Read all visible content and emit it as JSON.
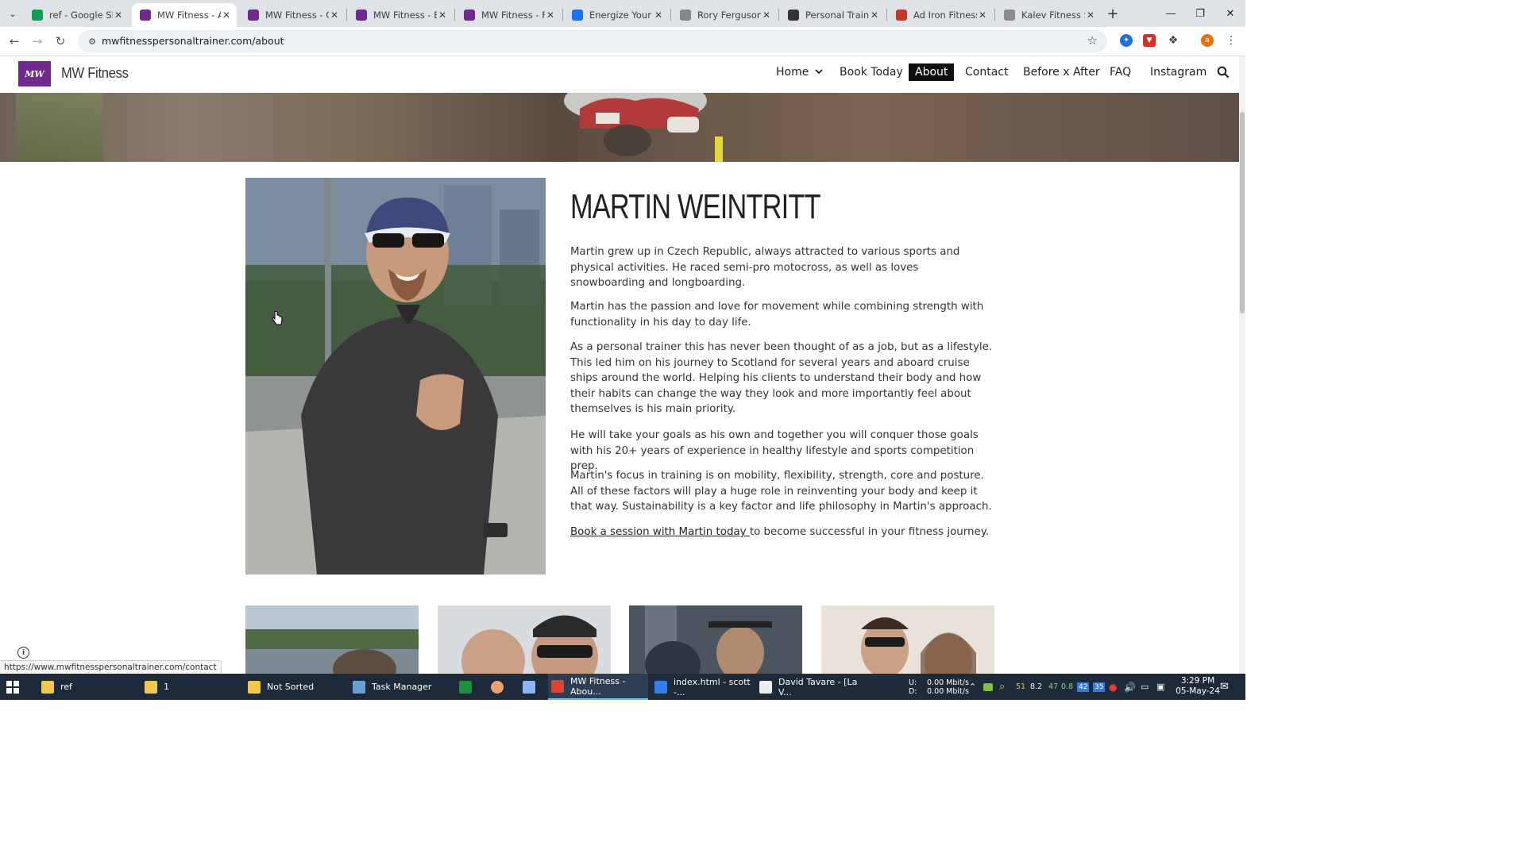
{
  "browser": {
    "tabs": [
      {
        "title": "ref - Google Shee",
        "favicon_color": "#0f9d58",
        "active": false
      },
      {
        "title": "MW Fitness - Abo",
        "favicon_color": "#6f2a8e",
        "active": true
      },
      {
        "title": "MW Fitness - Con",
        "favicon_color": "#6f2a8e",
        "active": false
      },
      {
        "title": "MW Fitness - Befo",
        "favicon_color": "#6f2a8e",
        "active": false
      },
      {
        "title": "MW Fitness - FAQ",
        "favicon_color": "#6f2a8e",
        "active": false
      },
      {
        "title": "Energize Your Fitn",
        "favicon_color": "#1a73e8",
        "active": false
      },
      {
        "title": "Rory Ferguson - P",
        "favicon_color": "#888888",
        "active": false
      },
      {
        "title": "Personal Trainer V",
        "favicon_color": "#333333",
        "active": false
      },
      {
        "title": "Ad Iron Fitness",
        "favicon_color": "#c0392b",
        "active": false
      },
      {
        "title": "Kalev Fitness Solu",
        "favicon_color": "#8a8a8a",
        "active": false
      }
    ],
    "url": "mwfitnesspersonaltrainer.com/about",
    "profile_initial": "a",
    "status_url": "https://www.mwfitnesspersonaltrainer.com/contact"
  },
  "site": {
    "logo_text": "MW",
    "brand": "MW Fitness",
    "nav": {
      "home": "Home",
      "book": "Book Today",
      "about": "About",
      "contact": "Contact",
      "before_after": "Before x After",
      "faq": "FAQ",
      "instagram": "Instagram"
    }
  },
  "about": {
    "name": "MARTIN WEINTRITT",
    "paragraphs": [
      "Martin grew up in Czech Republic, always attracted to various sports and physical activities. He raced semi-pro motocross, as well as loves snowboarding and longboarding.",
      "Martin has the passion and love for movement while combining strength with functionality in his day to day life.",
      "As a personal trainer this has never been thought of as a job, but as a lifestyle. This led him on his journey to Scotland for several years and aboard cruise ships around the world. Helping his clients to understand their body and how their habits can change the way they look and more importantly feel about themselves is his main priority.",
      "He will take your goals as his own and together you will conquer those goals with his 20+ years of experience in healthy lifestyle and sports competition prep.",
      "Martin's focus in training is on mobility, flexibility, strength, core and posture. All of these factors will play a huge role in reinventing your body and keep it that way. Sustainability is a key factor and life philosophy in Martin's approach."
    ],
    "book_link": "Book a session with Martin today ",
    "book_suffix": "to become successful in your fitness journey."
  },
  "taskbar": {
    "items": [
      {
        "label": "ref",
        "icon_color": "#f2c94c"
      },
      {
        "label": "1",
        "icon_color": "#f2c94c"
      },
      {
        "label": "Not Sorted",
        "icon_color": "#f2c94c"
      },
      {
        "label": "Task Manager",
        "icon_color": "#6a9fd4"
      },
      {
        "label": "MW Fitness - Abou...",
        "icon_color": "#db4437"
      },
      {
        "label": "index.html - scott -...",
        "icon_color": "#2f80ed"
      },
      {
        "label": "David Tavare - [La V...",
        "icon_color": "#eeeeee"
      }
    ],
    "net_up_label": "U:",
    "net_down_label": "D:",
    "net_up": "0.00 Mbit/s",
    "net_down": "0.00 Mbit/s",
    "tray_numbers": [
      "51",
      "8.2",
      "47",
      "0.8"
    ],
    "tray_badges": [
      "42",
      "35"
    ],
    "time": "3:29 PM",
    "date": "05-May-24"
  }
}
